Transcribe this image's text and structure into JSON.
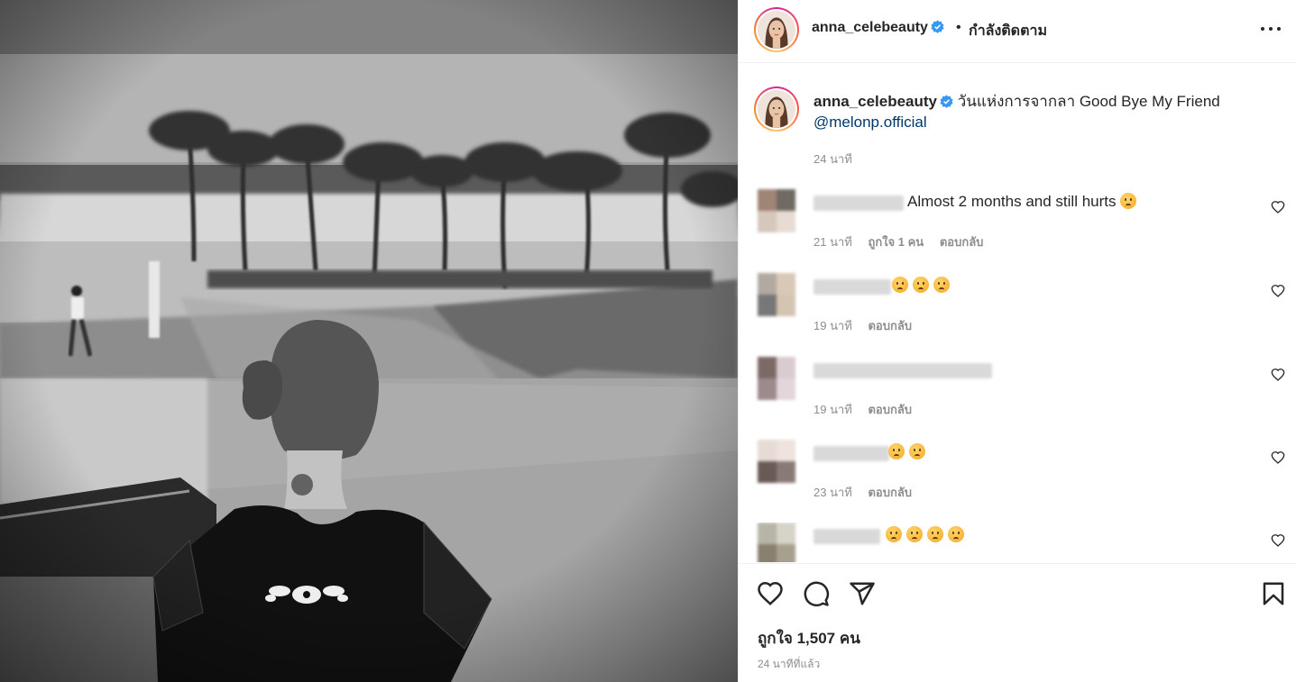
{
  "header": {
    "username": "anna_celebeauty",
    "separator": "•",
    "follow_status": "กำลังติดตาม"
  },
  "caption": {
    "username": "anna_celebeauty",
    "text": "วันแห่งการจากลา Good Bye My Friend",
    "mention": "@melonp.official",
    "time": "24 นาที"
  },
  "comments": [
    {
      "text": "Almost 2 months and still hurts",
      "emoji_count": 1,
      "time": "21 นาที",
      "likes": "ถูกใจ 1 คน",
      "reply": "ตอบกลับ"
    },
    {
      "text": "",
      "emoji_count": 3,
      "time": "19 นาที",
      "likes": "",
      "reply": "ตอบกลับ"
    },
    {
      "text": "",
      "emoji_count": 0,
      "time": "19 นาที",
      "likes": "",
      "reply": "ตอบกลับ"
    },
    {
      "text": "",
      "emoji_count": 2,
      "time": "23 นาที",
      "likes": "",
      "reply": "ตอบกลับ"
    },
    {
      "text": "",
      "emoji_count": 4,
      "time": "",
      "likes": "",
      "reply": ""
    }
  ],
  "footer": {
    "likes": "ถูกใจ 1,507 คน",
    "ago": "24 นาทีที่แล้ว"
  },
  "icons": [
    "verified-badge-icon",
    "more-options-icon",
    "heart-icon",
    "comment-icon",
    "share-icon",
    "bookmark-icon"
  ],
  "colors": {
    "verified": "#3897f0",
    "mention": "#00376b",
    "muted": "#8e8e8e",
    "text": "#262626",
    "border": "#efefef"
  }
}
